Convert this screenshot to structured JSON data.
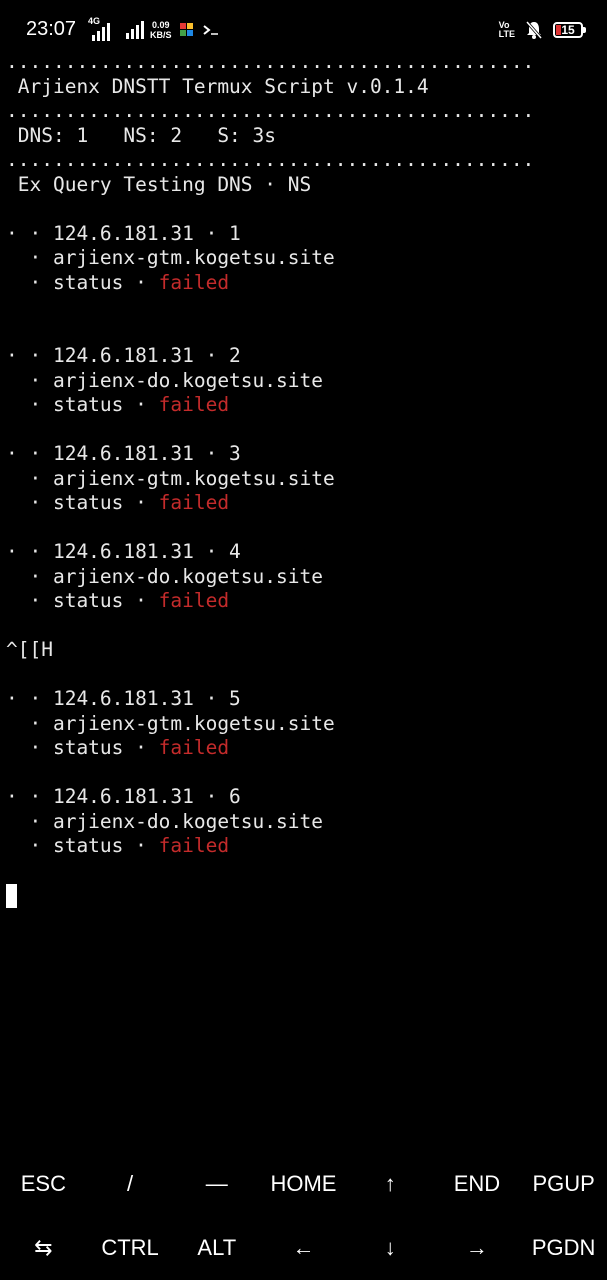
{
  "status_bar": {
    "time": "23:07",
    "network_tag": "4G",
    "speed_value": "0.09",
    "speed_unit": "KB/S",
    "volte_top": "Vo",
    "volte_bottom": "LTE",
    "battery_level": "15"
  },
  "terminal": {
    "lines": [
      ".............................................",
      " Arjienx DNSTT Termux Script v.0.1.4",
      ".............................................",
      " DNS: 1   NS: 2   S: 3s",
      ".............................................",
      " Ex Query Testing DNS · NS",
      "",
      "· · 124.6.181.31 · 1",
      "  · arjienx-gtm.kogetsu.site",
      "  · status · ",
      "",
      "",
      "· · 124.6.181.31 · 2",
      "  · arjienx-do.kogetsu.site",
      "  · status · ",
      "",
      "· · 124.6.181.31 · 3",
      "  · arjienx-gtm.kogetsu.site",
      "  · status · ",
      "",
      "· · 124.6.181.31 · 4",
      "  · arjienx-do.kogetsu.site",
      "  · status · ",
      "",
      "^[[H",
      "",
      "· · 124.6.181.31 · 5",
      "  · arjienx-gtm.kogetsu.site",
      "  · status · ",
      "",
      "· · 124.6.181.31 · 6",
      "  · arjienx-do.kogetsu.site",
      "  · status · "
    ],
    "status_word": "failed",
    "failed_color": "#c42b2b"
  },
  "extra_keys": {
    "row1": [
      "ESC",
      "/",
      "—",
      "HOME",
      "↑",
      "END",
      "PGUP"
    ],
    "row2": [
      "⇆",
      "CTRL",
      "ALT",
      "←",
      "↓",
      "→",
      "PGDN"
    ]
  }
}
